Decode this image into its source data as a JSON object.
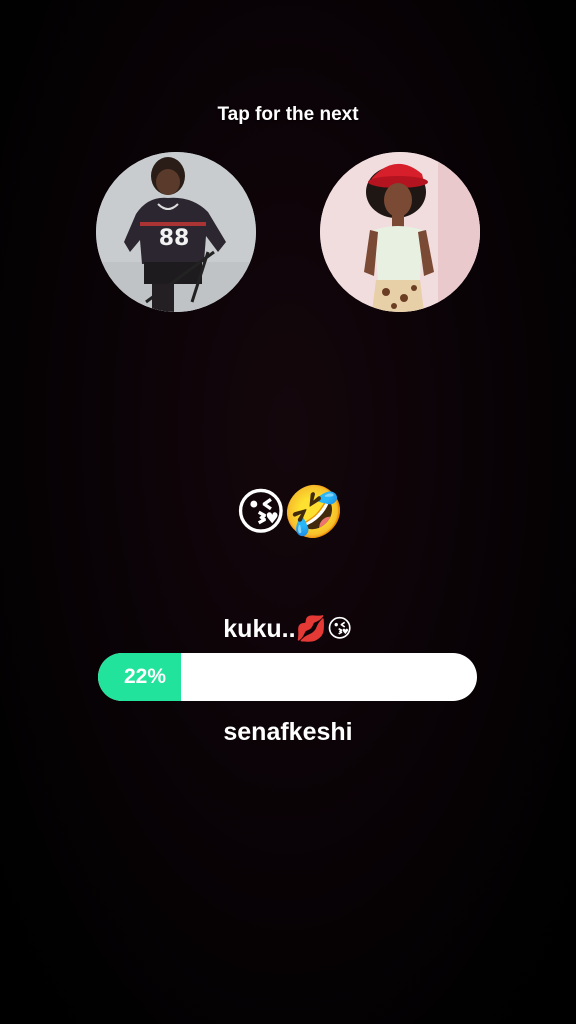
{
  "prompt": {
    "hint_text": "Tap for the next"
  },
  "avatars": {
    "left": {
      "icon": "person-photo-jersey-88",
      "jersey_number": "88"
    },
    "right": {
      "icon": "person-photo-red-cap"
    }
  },
  "reaction": {
    "emojis": "😘🤣"
  },
  "poll": {
    "option_top": "kuku..💋😘",
    "option_bottom": "senafkeshi",
    "percent_label": "22%",
    "fill_fraction": 0.22,
    "colors": {
      "fill": "#22e39b",
      "track": "#ffffff"
    }
  }
}
